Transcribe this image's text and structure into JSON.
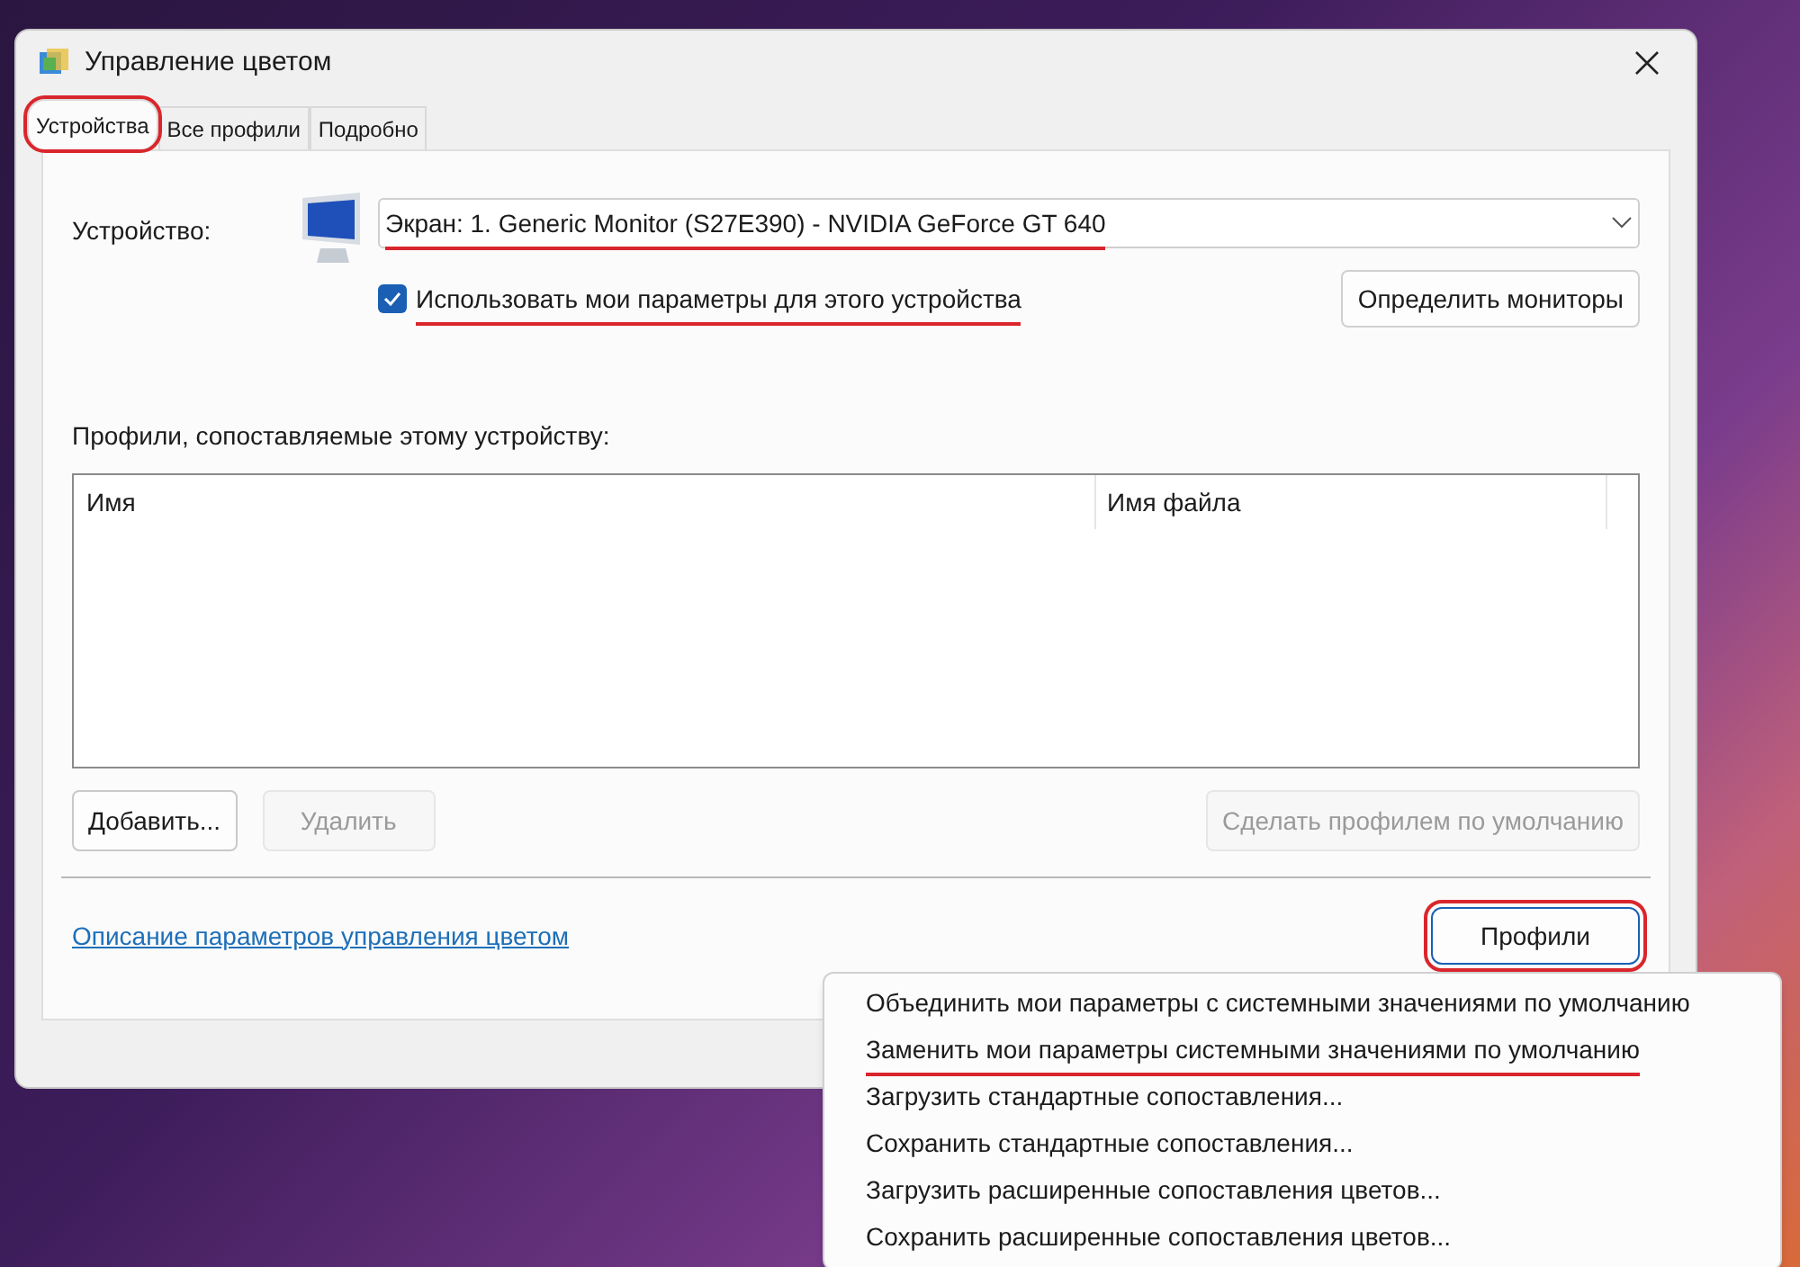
{
  "window": {
    "title": "Управление цветом"
  },
  "tabs": [
    {
      "label": "Устройства",
      "selected": true,
      "marked": true
    },
    {
      "label": "Все профили",
      "selected": false,
      "marked": false
    },
    {
      "label": "Подробно",
      "selected": false,
      "marked": false
    }
  ],
  "device": {
    "label": "Устройство:",
    "value": "Экран: 1. Generic Monitor (S27E390) - NVIDIA GeForce GT 640",
    "marked": true
  },
  "use_my_settings": {
    "label": "Использовать мои параметры для этого устройства",
    "checked": true,
    "marked": true
  },
  "identify_button": {
    "label": "Определить мониторы",
    "disabled": false
  },
  "profiles_label": "Профили, сопоставляемые этому устройству:",
  "table": {
    "columns": [
      "Имя",
      "Имя файла"
    ]
  },
  "action_buttons": [
    {
      "label": "Добавить...",
      "disabled": false
    },
    {
      "label": "Удалить",
      "disabled": true
    },
    {
      "label": "Сделать профилем по умолчанию",
      "disabled": true
    }
  ],
  "link": "Описание параметров управления цветом",
  "profiles_button": {
    "label": "Профили",
    "marked": true
  },
  "menu": [
    {
      "label": "Объединить мои параметры с системными значениями по умолчанию",
      "marked": false
    },
    {
      "label": "Заменить мои параметры системными значениями по умолчанию",
      "marked": true
    },
    {
      "label": "Загрузить стандартные сопоставления...",
      "marked": false
    },
    {
      "label": "Сохранить стандартные сопоставления...",
      "marked": false
    },
    {
      "label": "Загрузить расширенные сопоставления цветов...",
      "marked": false
    },
    {
      "label": "Сохранить расширенные сопоставления цветов...",
      "marked": false
    }
  ]
}
